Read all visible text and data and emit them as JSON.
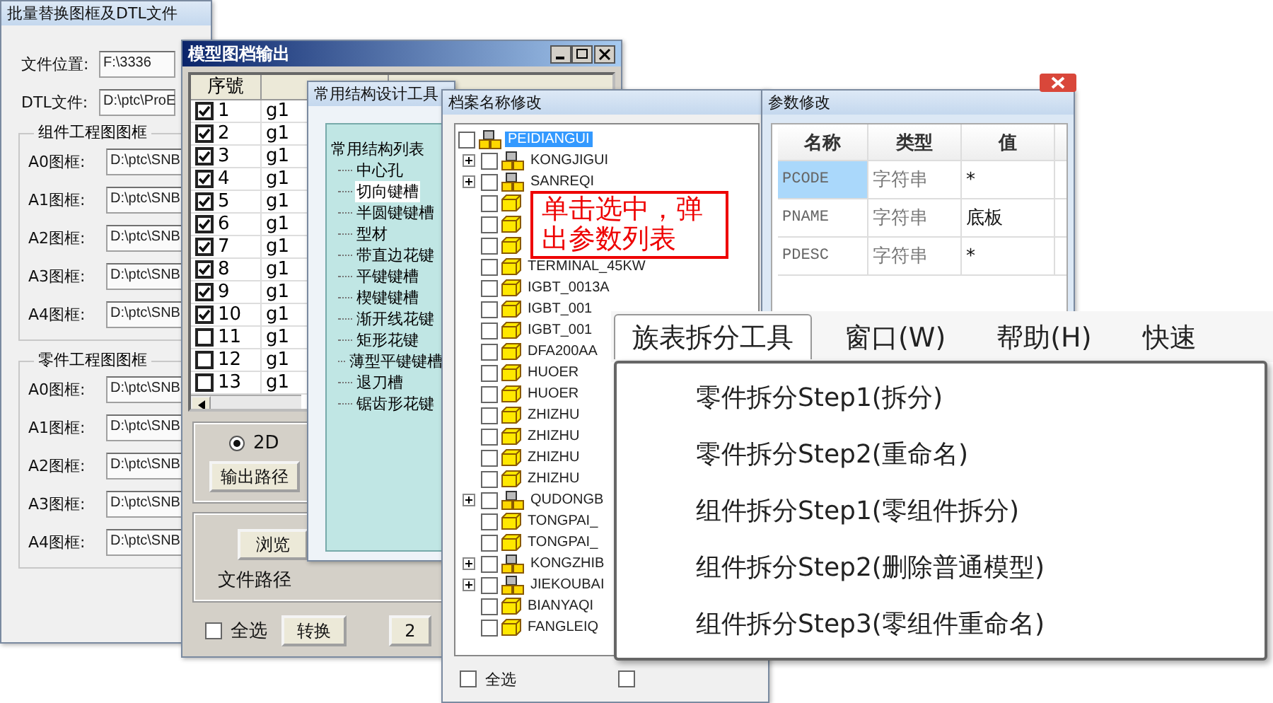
{
  "replace_window": {
    "title": "批量替换图框及DTL文件",
    "fields": [
      {
        "label": "文件位置:",
        "value": "F:\\3336"
      },
      {
        "label": "DTL文件:",
        "value": "D:\\ptc\\ProE"
      }
    ],
    "groups": [
      {
        "title": "组件工程图图框",
        "fields": [
          {
            "label": "A0图框:",
            "value": "D:\\ptc\\SNB"
          },
          {
            "label": "A1图框:",
            "value": "D:\\ptc\\SNB"
          },
          {
            "label": "A2图框:",
            "value": "D:\\ptc\\SNB"
          },
          {
            "label": "A3图框:",
            "value": "D:\\ptc\\SNB"
          },
          {
            "label": "A4图框:",
            "value": "D:\\ptc\\SNB"
          }
        ]
      },
      {
        "title": "零件工程图图框",
        "fields": [
          {
            "label": "A0图框:",
            "value": "D:\\ptc\\SNB"
          },
          {
            "label": "A1图框:",
            "value": "D:\\ptc\\SNB"
          },
          {
            "label": "A2图框:",
            "value": "D:\\ptc\\SNB"
          },
          {
            "label": "A3图框:",
            "value": "D:\\ptc\\SNB"
          },
          {
            "label": "A4图框:",
            "value": "D:\\ptc\\SNB"
          }
        ]
      }
    ]
  },
  "export_window": {
    "title": "模型图档输出",
    "index_header": "序號",
    "rows": [
      {
        "index": "1",
        "checked": true,
        "name": "g1"
      },
      {
        "index": "2",
        "checked": true,
        "name": "g1"
      },
      {
        "index": "3",
        "checked": true,
        "name": "g1"
      },
      {
        "index": "4",
        "checked": true,
        "name": "g1"
      },
      {
        "index": "5",
        "checked": true,
        "name": "g1"
      },
      {
        "index": "6",
        "checked": true,
        "name": "g1"
      },
      {
        "index": "7",
        "checked": true,
        "name": "g1"
      },
      {
        "index": "8",
        "checked": true,
        "name": "g1"
      },
      {
        "index": "9",
        "checked": true,
        "name": "g1"
      },
      {
        "index": "10",
        "checked": true,
        "name": "g1"
      },
      {
        "index": "11",
        "checked": false,
        "name": "g1"
      },
      {
        "index": "12",
        "checked": false,
        "name": "g1"
      },
      {
        "index": "13",
        "checked": false,
        "name": "g1"
      }
    ],
    "radios": [
      {
        "label": "2D",
        "selected": true
      }
    ],
    "output_button": "输出路径",
    "browse_button": "浏览",
    "path_label": "文件路径",
    "select_all": {
      "label": "全选",
      "checked": false
    },
    "convert_button": "转换",
    "other_button": "2"
  },
  "structure_tool": {
    "title": "常用结构设计工具",
    "tree": {
      "label": "常用结构列表",
      "children": [
        {
          "label": "中心孔",
          "selected": false
        },
        {
          "label": "切向键槽",
          "selected": true
        },
        {
          "label": "半圆键键槽",
          "selected": false
        },
        {
          "label": "型材",
          "selected": false
        },
        {
          "label": "带直边花键",
          "selected": false
        },
        {
          "label": "平键键槽",
          "selected": false
        },
        {
          "label": "楔键键槽",
          "selected": false
        },
        {
          "label": "渐开线花键",
          "selected": false
        },
        {
          "label": "矩形花键",
          "selected": false
        },
        {
          "label": "薄型平键键槽",
          "selected": false
        },
        {
          "label": "退刀槽",
          "selected": false
        },
        {
          "label": "锯齿形花键",
          "selected": false
        }
      ]
    }
  },
  "rename_window": {
    "title": "档案名称修改",
    "tree": {
      "label": "PEIDIANGUI",
      "kind": "assembly",
      "checked": false,
      "selected": true,
      "children": [
        {
          "label": "KONGJIGUI",
          "kind": "assembly",
          "expanded": false,
          "checked": false
        },
        {
          "label": "SANREQI",
          "kind": "assembly",
          "expanded": false,
          "checked": false
        },
        {
          "kind": "part",
          "checked": false
        },
        {
          "kind": "part",
          "checked": false
        },
        {
          "kind": "part",
          "checked": false
        },
        {
          "label": "TERMINAL_45KW",
          "kind": "part",
          "checked": false
        },
        {
          "label": "IGBT_0013A",
          "kind": "part",
          "checked": false
        },
        {
          "label": "IGBT_001",
          "kind": "part",
          "checked": false
        },
        {
          "label": "IGBT_001",
          "kind": "part",
          "checked": false
        },
        {
          "label": "DFA200AA",
          "kind": "part",
          "checked": false
        },
        {
          "label": "HUOER",
          "kind": "part",
          "checked": false
        },
        {
          "label": "HUOER",
          "kind": "part",
          "checked": false
        },
        {
          "label": "ZHIZHU",
          "kind": "part",
          "checked": false
        },
        {
          "label": "ZHIZHU",
          "kind": "part",
          "checked": false
        },
        {
          "label": "ZHIZHU",
          "kind": "part",
          "checked": false
        },
        {
          "label": "ZHIZHU",
          "kind": "part",
          "checked": false
        },
        {
          "label": "QUDONGB",
          "kind": "assembly",
          "expanded": false,
          "checked": false
        },
        {
          "label": "TONGPAI_",
          "kind": "part",
          "checked": false
        },
        {
          "label": "TONGPAI_",
          "kind": "part",
          "checked": false
        },
        {
          "label": "KONGZHIB",
          "kind": "assembly",
          "expanded": false,
          "checked": false
        },
        {
          "label": "JIEKOUBAI",
          "kind": "assembly",
          "expanded": false,
          "checked": false
        },
        {
          "label": "BIANYAQI",
          "kind": "part",
          "checked": false
        },
        {
          "label": "FANGLEIQ",
          "kind": "part",
          "checked": false
        }
      ]
    },
    "select_all": {
      "label": "全选",
      "checked": false
    },
    "other_checkbox": {
      "checked": false
    }
  },
  "annotation": {
    "text": "单击选中，弹出参数列表"
  },
  "param_window": {
    "title": "参数修改",
    "columns": [
      "名称",
      "类型",
      "值"
    ],
    "rows": [
      {
        "name": "PCODE",
        "type": "字符串",
        "value": "*",
        "selected": true
      },
      {
        "name": "PNAME",
        "type": "字符串",
        "value": "底板",
        "selected": false
      },
      {
        "name": "PDESC",
        "type": "字符串",
        "value": "*",
        "selected": false
      }
    ]
  },
  "menu": {
    "items": [
      {
        "label": "族表拆分工具",
        "selected": true
      },
      {
        "label": "窗口(W)",
        "selected": false
      },
      {
        "label": "帮助(H)",
        "selected": false
      },
      {
        "label": "快速",
        "selected": false
      }
    ],
    "dropdown": [
      "零件拆分Step1(拆分)",
      "零件拆分Step2(重命名)",
      "组件拆分Step1(零组件拆分)",
      "组件拆分Step2(删除普通模型)",
      "组件拆分Step3(零组件重命名)"
    ]
  }
}
